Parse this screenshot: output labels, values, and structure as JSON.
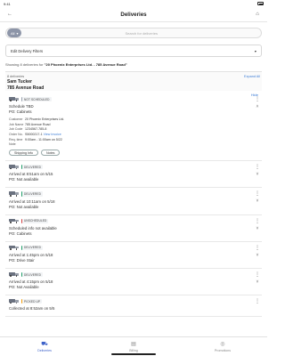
{
  "status": {
    "time": "9:41"
  },
  "header": {
    "title": "Deliveries"
  },
  "search": {
    "scope": "All",
    "placeholder": "Search for deliveries"
  },
  "filters": {
    "label": "Edit Delivery Filters"
  },
  "summary": {
    "prefix": "Showing 8 deliveries for ",
    "emphasis": "\"20 Phoenix Enterprises Ltd. - 785 Avenue Road\""
  },
  "panel": {
    "count": "8 deliveries",
    "expand_all": "Expand All",
    "customer": "Sam Tucker",
    "address": "785 Avenue Road",
    "hide": "Hide"
  },
  "cards": [
    {
      "status": "NOT SCHEDULED",
      "lines": [
        "Schedule TBD",
        "PO: Cabinets"
      ],
      "details": [
        {
          "k": "Customer",
          "v": "20 Phoenix Enterprises Ltd."
        },
        {
          "k": "Job Name",
          "v": "785 Avenue Road"
        },
        {
          "k": "Job Code",
          "v": "1234567-785-8"
        },
        {
          "k": "Order No.",
          "v": "S5000217-1",
          "link": "View Invoice"
        },
        {
          "k": "Req. time",
          "v": "9:00am - 11:00am on 5/22"
        },
        {
          "k": "Note",
          "v": ""
        }
      ],
      "buttons": [
        "Shipping Info",
        "Notes"
      ]
    },
    {
      "status": "DELIVERED",
      "lines": [
        "Arrived at 8:51am on 5/15",
        "PO: Not available"
      ]
    },
    {
      "status": "DELIVERED",
      "lines": [
        "Arrived at 10:11am on 5/18",
        "PO: Not available"
      ]
    },
    {
      "status": "UNSCHEDULED",
      "lines": [
        "Scheduled info not available",
        "PO: Cabinets"
      ]
    },
    {
      "status": "DELIVERED",
      "lines": [
        "Arrived at 1:45pm on 5/18",
        "PO: Drive Stair"
      ]
    },
    {
      "status": "DELIVERED",
      "lines": [
        "Arrived at 4:15pm on 5/18",
        "PO: Not Available"
      ]
    },
    {
      "status": "PICKED UP",
      "lines": [
        "Collected at 8:52am on 5/5"
      ]
    }
  ],
  "tabs": [
    {
      "label": "Deliveries",
      "icon": "truck-icon"
    },
    {
      "label": "Billing",
      "icon": "billing-icon"
    },
    {
      "label": "Promotions",
      "icon": "promotions-icon"
    }
  ],
  "colors": {
    "accent": "#3a5fc8",
    "link": "#3a7bd5",
    "delivered": "#22a06b",
    "not_scheduled": "#9ca3af",
    "unscheduled": "#d64545",
    "picked_up": "#f59e0b"
  }
}
